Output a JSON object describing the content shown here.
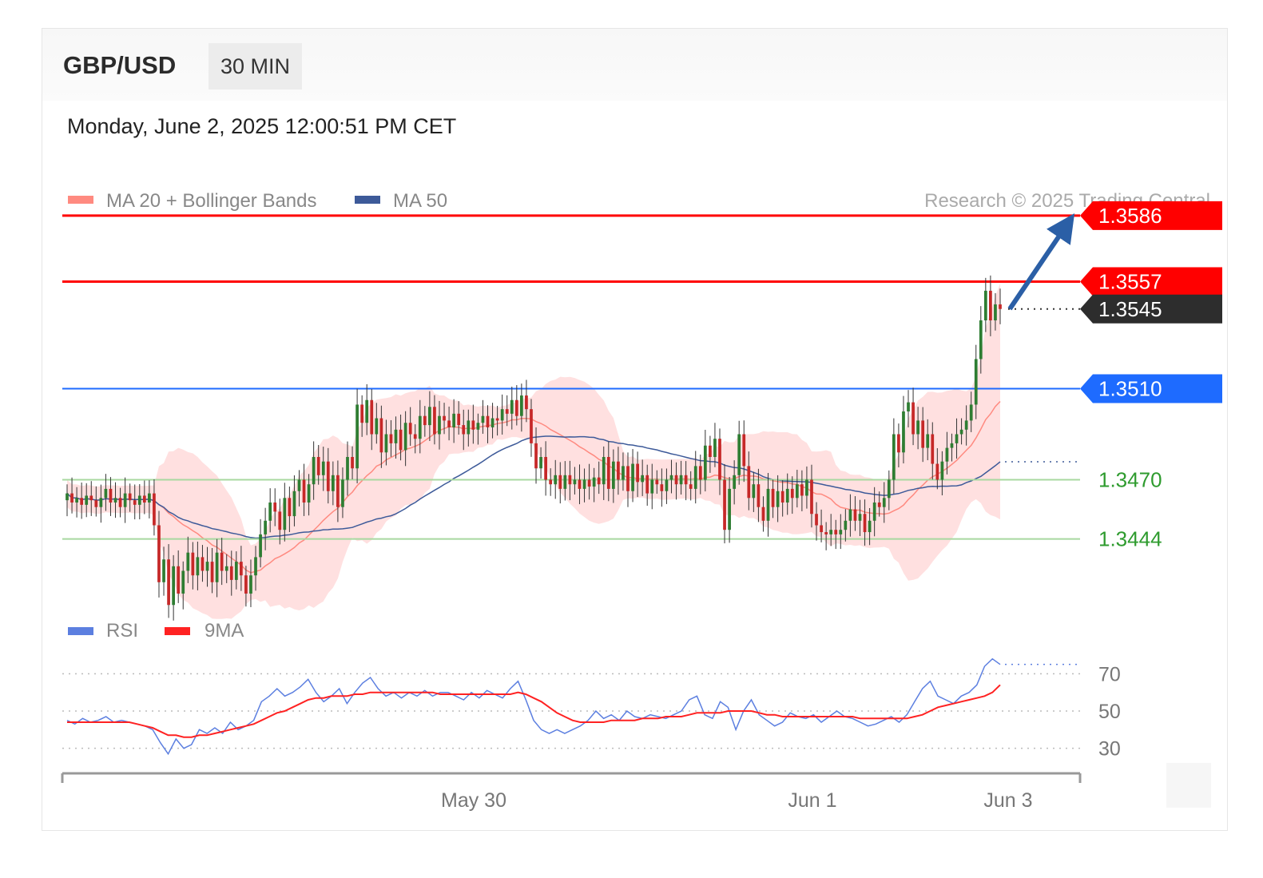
{
  "header": {
    "pair": "GBP/USD",
    "timeframe": "30 MIN",
    "datetime": "Monday, June 2, 2025 12:00:51 PM CET"
  },
  "legend": {
    "ma20_label": "MA 20 + Bollinger Bands",
    "ma50_label": "MA 50",
    "credit": "Research © 2025 Trading Central",
    "rsi_label": "RSI",
    "rsi_ma_label": "9MA"
  },
  "colors": {
    "resistance": "#ff0000",
    "pivot": "#1e6bff",
    "support": "#a8d8a0",
    "support_text": "#2e9b2e",
    "last_price": "#2d2d2d",
    "bull_candle": "#2e7d32",
    "bear_candle": "#c62828",
    "bollinger_fill": "#ffe0e0",
    "ma20": "#ff8a80",
    "ma50": "#3d5a99",
    "rsi": "#5c7fe0",
    "rsi_ma": "#ff2222",
    "arrow": "#2b5fa6"
  },
  "chart_data": [
    {
      "type": "candlestick",
      "title": "GBP/USD",
      "timeframe": "30 MIN",
      "x_ticks": [
        "May 30",
        "Jun 1",
        "Jun 3"
      ],
      "ylim": [
        1.34,
        1.36
      ],
      "levels": [
        {
          "value": 1.3586,
          "label": "1.3586",
          "kind": "resistance"
        },
        {
          "value": 1.3557,
          "label": "1.3557",
          "kind": "resistance"
        },
        {
          "value": 1.3545,
          "label": "1.3545",
          "kind": "last"
        },
        {
          "value": 1.351,
          "label": "1.3510",
          "kind": "pivot"
        },
        {
          "value": 1.347,
          "label": "1.3470",
          "kind": "support"
        },
        {
          "value": 1.3444,
          "label": "1.3444",
          "kind": "support"
        }
      ],
      "forecast_arrow": {
        "from": 1.3545,
        "to": 1.3586
      },
      "close_series": [
        1.3464,
        1.346,
        1.3462,
        1.3459,
        1.3463,
        1.3461,
        1.3458,
        1.3462,
        1.3466,
        1.346,
        1.3462,
        1.3458,
        1.3464,
        1.3461,
        1.3459,
        1.3463,
        1.346,
        1.3464,
        1.345,
        1.3425,
        1.3435,
        1.3415,
        1.3432,
        1.342,
        1.343,
        1.3438,
        1.3428,
        1.3436,
        1.343,
        1.3434,
        1.3425,
        1.3438,
        1.343,
        1.3432,
        1.3426,
        1.3434,
        1.3428,
        1.342,
        1.3428,
        1.3436,
        1.3446,
        1.3452,
        1.346,
        1.3456,
        1.3448,
        1.3462,
        1.3454,
        1.3465,
        1.347,
        1.346,
        1.3468,
        1.348,
        1.3472,
        1.3478,
        1.3465,
        1.3472,
        1.3458,
        1.347,
        1.348,
        1.3475,
        1.3503,
        1.3495,
        1.3505,
        1.349,
        1.3497,
        1.3482,
        1.349,
        1.3486,
        1.3492,
        1.3483,
        1.3495,
        1.349,
        1.3488,
        1.3498,
        1.3494,
        1.3502,
        1.349,
        1.3498,
        1.3496,
        1.3493,
        1.3499,
        1.3494,
        1.349,
        1.3496,
        1.3492,
        1.3495,
        1.3498,
        1.3493,
        1.3497,
        1.3496,
        1.3501,
        1.3499,
        1.3505,
        1.3498,
        1.3507,
        1.3501,
        1.3486,
        1.3475,
        1.348,
        1.347,
        1.3468,
        1.3472,
        1.3466,
        1.3472,
        1.3468,
        1.347,
        1.3466,
        1.347,
        1.3467,
        1.3471,
        1.3468,
        1.348,
        1.3466,
        1.3478,
        1.347,
        1.3476,
        1.3465,
        1.3477,
        1.3469,
        1.3472,
        1.3464,
        1.347,
        1.3468,
        1.3465,
        1.347,
        1.3472,
        1.3468,
        1.3472,
        1.3468,
        1.3466,
        1.3476,
        1.347,
        1.3485,
        1.348,
        1.3488,
        1.347,
        1.3448,
        1.3466,
        1.3472,
        1.349,
        1.3476,
        1.3462,
        1.3468,
        1.3458,
        1.3452,
        1.3466,
        1.3458,
        1.3465,
        1.346,
        1.3466,
        1.3462,
        1.3468,
        1.3463,
        1.347,
        1.3455,
        1.345,
        1.3447,
        1.3446,
        1.3448,
        1.3446,
        1.3448,
        1.3452,
        1.3457,
        1.3452,
        1.3455,
        1.3447,
        1.3452,
        1.346,
        1.3458,
        1.3462,
        1.347,
        1.349,
        1.3482,
        1.35,
        1.3504,
        1.349,
        1.3496,
        1.3484,
        1.349,
        1.3477,
        1.347,
        1.3478,
        1.3484,
        1.3486,
        1.349,
        1.3492,
        1.3496,
        1.3503,
        1.3523,
        1.354,
        1.3553,
        1.354,
        1.3547,
        1.3545
      ]
    },
    {
      "type": "line",
      "title": "RSI",
      "series": [
        {
          "name": "RSI",
          "values": [
            45,
            43,
            46,
            44,
            45,
            47,
            44,
            45,
            44,
            43,
            42,
            40,
            33,
            27,
            35,
            30,
            32,
            40,
            38,
            41,
            38,
            44,
            40,
            42,
            45,
            55,
            58,
            62,
            58,
            60,
            63,
            67,
            60,
            55,
            58,
            62,
            54,
            60,
            65,
            68,
            62,
            58,
            60,
            57,
            60,
            58,
            61,
            58,
            60,
            60,
            58,
            56,
            60,
            57,
            61,
            59,
            57,
            62,
            66,
            56,
            45,
            40,
            38,
            40,
            38,
            40,
            42,
            45,
            50,
            46,
            48,
            45,
            50,
            47,
            46,
            48,
            47,
            46,
            48,
            50,
            56,
            58,
            48,
            46,
            55,
            52,
            40,
            50,
            56,
            48,
            45,
            42,
            44,
            49,
            47,
            46,
            48,
            44,
            47,
            50,
            47,
            46,
            44,
            42,
            43,
            45,
            47,
            44,
            48,
            55,
            62,
            66,
            58,
            56,
            54,
            58,
            60,
            64,
            74,
            78,
            75
          ]
        },
        {
          "name": "9MA",
          "values": [
            44,
            44,
            44,
            44,
            44,
            44,
            44,
            44,
            44,
            43,
            42,
            41,
            39,
            37,
            37,
            36,
            36,
            37,
            37,
            38,
            39,
            40,
            41,
            42,
            43,
            45,
            47,
            49,
            50,
            52,
            54,
            56,
            57,
            57,
            58,
            58,
            58,
            59,
            59,
            60,
            60,
            60,
            60,
            60,
            60,
            60,
            60,
            60,
            59,
            59,
            59,
            59,
            59,
            59,
            59,
            59,
            59,
            59,
            60,
            59,
            57,
            55,
            52,
            49,
            47,
            45,
            44,
            44,
            44,
            44,
            45,
            45,
            45,
            45,
            46,
            46,
            46,
            47,
            47,
            47,
            48,
            49,
            49,
            49,
            49,
            50,
            50,
            50,
            50,
            49,
            48,
            48,
            47,
            47,
            47,
            47,
            47,
            47,
            47,
            47,
            47,
            47,
            46,
            46,
            46,
            46,
            46,
            46,
            46,
            47,
            48,
            50,
            52,
            53,
            54,
            55,
            56,
            57,
            58,
            60,
            64
          ]
        }
      ],
      "ylim": [
        20,
        80
      ],
      "y_ticks": [
        "70",
        "50",
        "30"
      ],
      "guides": [
        70,
        50,
        30
      ]
    }
  ]
}
